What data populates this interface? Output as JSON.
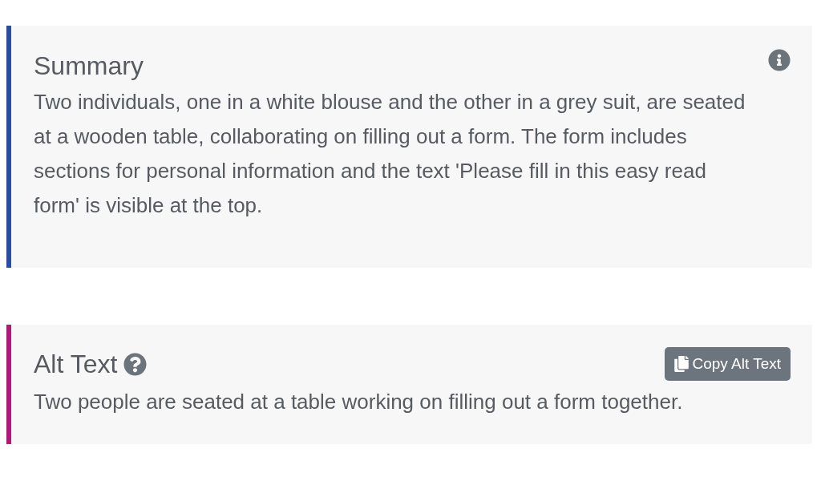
{
  "sections": [
    {
      "kind": "summary",
      "title": "Summary",
      "color": "#2a4da0",
      "text": "Two individuals, one in a white blouse and the other in a grey suit, are seated at a wooden table, collaborating on filling out a form. The form includes sections for personal information and the text 'Please fill in this easy read form' is visible at the top."
    },
    {
      "kind": "alt_text",
      "title": "Alt Text",
      "color": "#b0187a",
      "button": "Copy Alt Text",
      "text": "Two people are seated at a table working on filling out a form together."
    }
  ]
}
